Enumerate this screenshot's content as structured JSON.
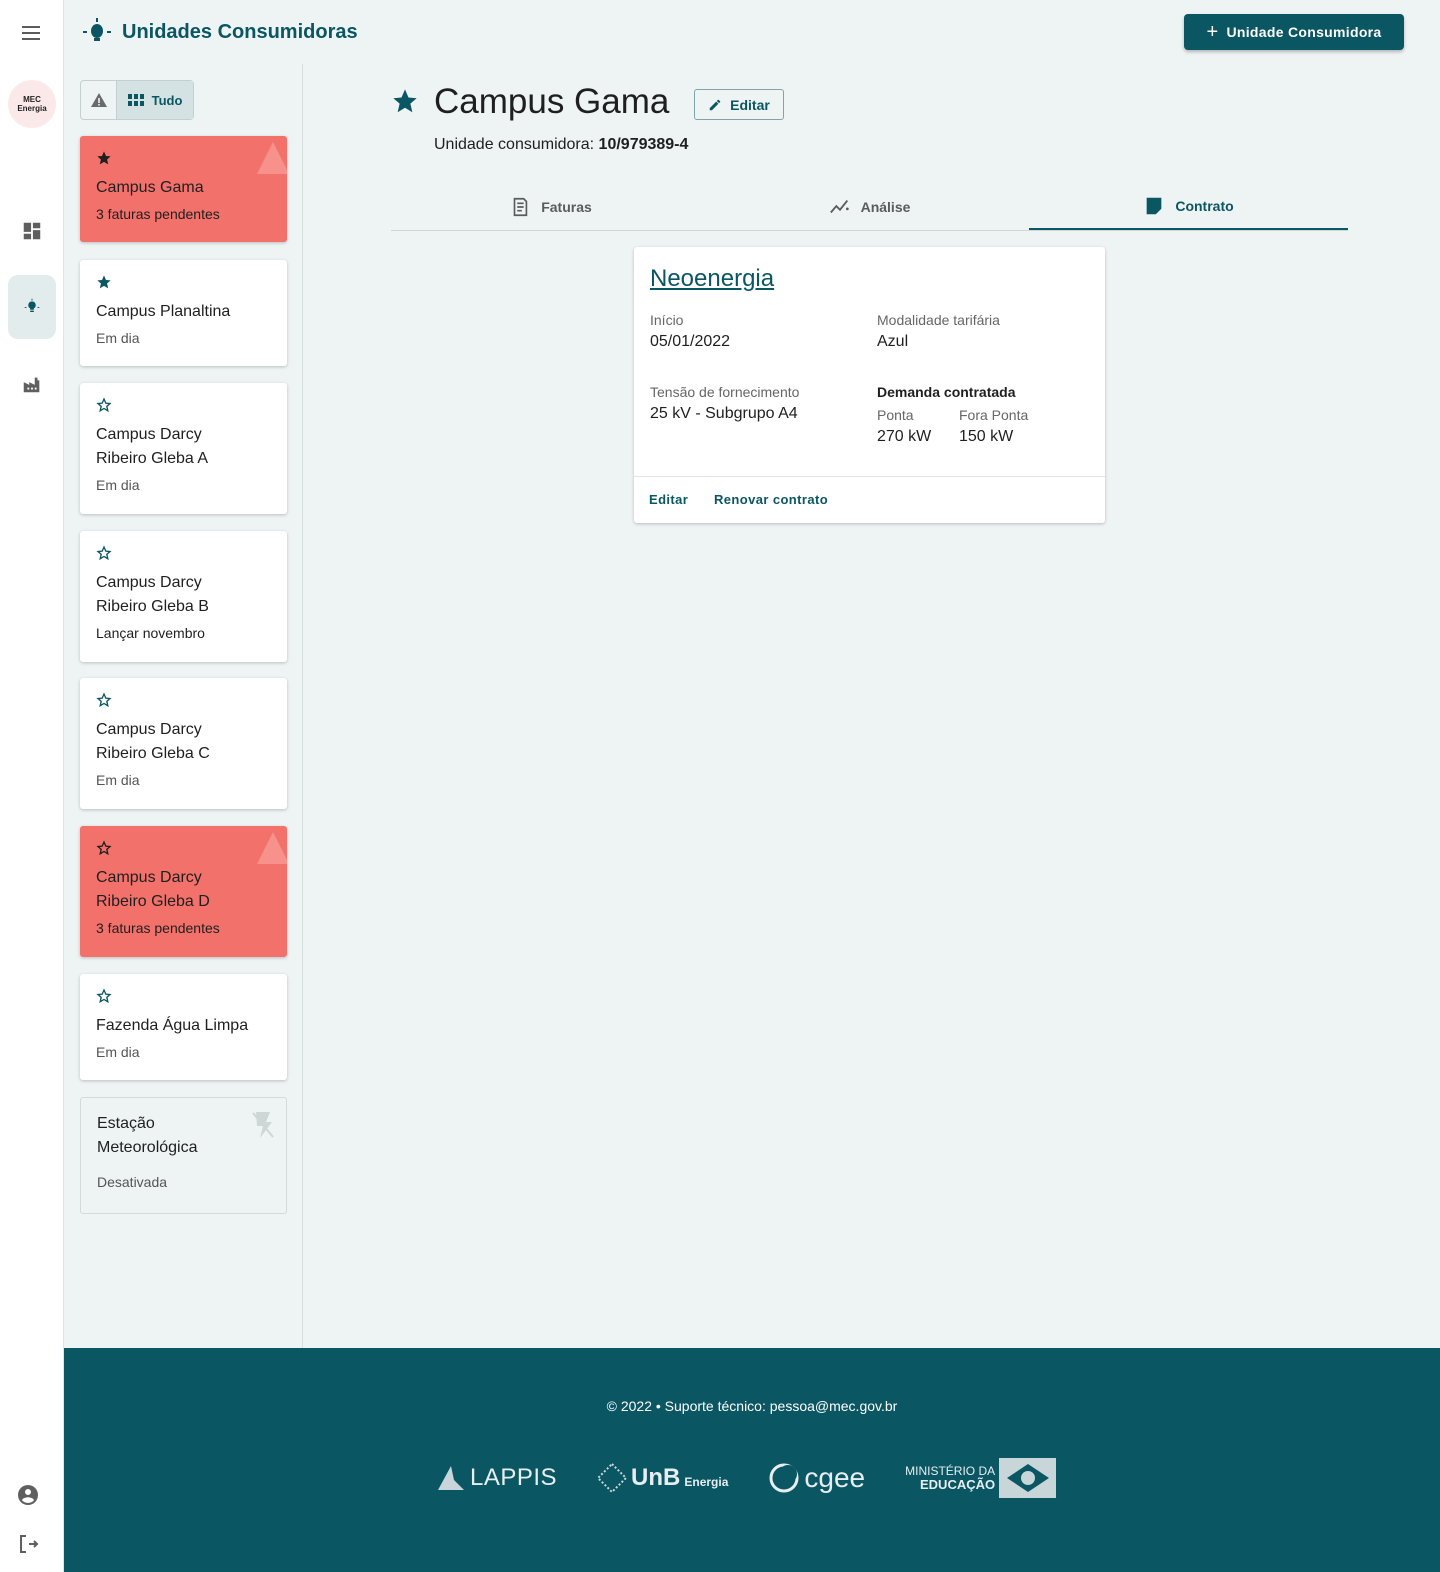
{
  "header": {
    "title": "Unidades Consumidoras",
    "add_button": "Unidade Consumidora"
  },
  "rail": {
    "logo_line1": "MEC",
    "logo_line2": "Energia",
    "items": [
      "menu-icon",
      "dashboard-icon",
      "lightbulb-icon",
      "factory-icon"
    ],
    "bottom": [
      "account-icon",
      "logout-icon"
    ]
  },
  "filter": {
    "all_label": "Tudo"
  },
  "units": [
    {
      "name": "Campus Gama",
      "status": "3 faturas pendentes",
      "favorite": true,
      "alert": true
    },
    {
      "name": "Campus Planaltina",
      "status": "Em dia",
      "favorite": true,
      "alert": false
    },
    {
      "name": "Campus Darcy Ribeiro Gleba A",
      "status": "Em dia",
      "favorite": false,
      "alert": false
    },
    {
      "name": "Campus Darcy Ribeiro Gleba B",
      "status": "Lançar novembro",
      "favorite": false,
      "alert": false
    },
    {
      "name": "Campus Darcy Ribeiro Gleba C",
      "status": "Em dia",
      "favorite": false,
      "alert": false
    },
    {
      "name": "Campus Darcy Ribeiro Gleba D",
      "status": "3 faturas pendentes",
      "favorite": false,
      "alert": true
    },
    {
      "name": "Fazenda Água Limpa",
      "status": "Em dia",
      "favorite": false,
      "alert": false
    },
    {
      "name": "Estação Meteorológica",
      "status": "Desativada",
      "favorite": false,
      "alert": false,
      "disabled": true
    }
  ],
  "detail": {
    "name": "Campus Gama",
    "edit_label": "Editar",
    "code_label": "Unidade consumidora:",
    "code_value": "10/979389-4",
    "tabs": [
      {
        "label": "Faturas",
        "icon": "receipt-icon"
      },
      {
        "label": "Análise",
        "icon": "analytics-icon"
      },
      {
        "label": "Contrato",
        "icon": "contract-icon",
        "active": true
      }
    ]
  },
  "contract": {
    "distributor": "Neoenergia",
    "start_label": "Início",
    "start_value": "05/01/2022",
    "tariff_label": "Modalidade tarifária",
    "tariff_value": "Azul",
    "voltage_label": "Tensão de fornecimento",
    "voltage_value": "25 kV - Subgrupo A4",
    "demand_label": "Demanda contratada",
    "peak_label": "Ponta",
    "peak_value": "270 kW",
    "offpeak_label": "Fora Ponta",
    "offpeak_value": "150 kW",
    "action_edit": "Editar",
    "action_renew": "Renovar contrato"
  },
  "footer": {
    "copyright": "© 2022  •  Suporte técnico: pessoa@mec.gov.br",
    "logos": {
      "lappis": "LAPPIS",
      "unb": "UnB",
      "unb_sub": "Energia",
      "cgee": "cgee",
      "mec_line1": "MINISTÉRIO DA",
      "mec_line2": "EDUCAÇÃO"
    }
  },
  "colors": {
    "primary": "#0b5663",
    "alert": "#f2716b",
    "background": "#eef3f3"
  }
}
